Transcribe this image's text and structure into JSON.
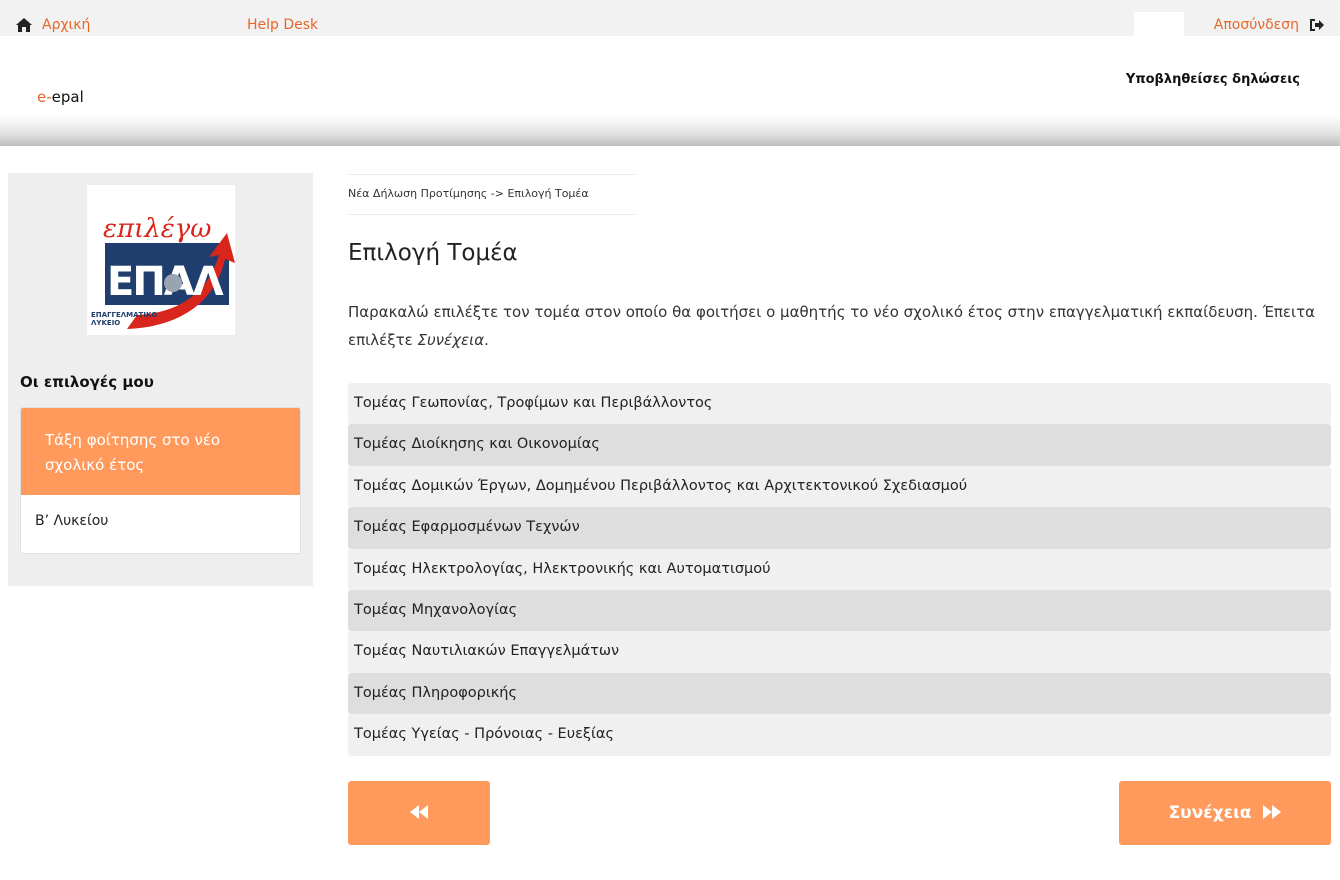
{
  "topbar": {
    "home_label": "Αρχική",
    "home_icon": "home-icon",
    "helpdesk_label": "Help Desk",
    "logout_label": "Αποσύνδεση",
    "logout_icon": "sign-out-icon"
  },
  "header": {
    "logo_prefix": "e-",
    "logo_name": "epal",
    "submitted_link": "Υποβληθείσες δηλώσεις"
  },
  "sidebar": {
    "logo_handwritten": "επιλέγω",
    "logo_letters": "ΕΠΑΛ",
    "logo_caption_line1": "ΕΠΑΓΓΕΛΜΑΤΙΚΟ",
    "logo_caption_line2": "ΛΥΚΕΙΟ",
    "choices_title": "Οι επιλογές μου",
    "card_title": "Τάξη φοίτησης στο νέο σχολικό έτος",
    "card_value": "Β’ Λυκείου"
  },
  "main": {
    "breadcrumb": "Νέα Δήλωση Προτίμησης -> Επιλογή Τομέα",
    "title": "Επιλογή Τομέα",
    "instructions_text": "Παρακαλώ επιλέξτε τον τομέα στον οποίο θα φοιτήσει ο μαθητής το νέο σχολικό έτος στην επαγγελματική εκπαίδευση. Έπειτα επιλέξτε ",
    "instructions_emphasis": "Συνέχεια",
    "instructions_end": ".",
    "sectors": [
      "Τομέας Γεωπονίας, Τροφίμων και Περιβάλλοντος",
      "Τομέας Διοίκησης και Οικονομίας",
      "Τομέας Δομικών Έργων, Δομημένου Περιβάλλοντος και Αρχιτεκτονικού Σχεδιασμού",
      "Τομέας Εφαρμοσμένων Τεχνών",
      "Τομέας Ηλεκτρολογίας, Ηλεκτρονικής και Αυτοματισμού",
      "Τομέας Μηχανολογίας",
      "Τομέας Ναυτιλιακών Επαγγελμάτων",
      "Τομέας Πληροφορικής",
      "Τομέας Υγείας - Πρόνοιας - Ευεξίας"
    ],
    "back_icon": "fast-backward-icon",
    "next_label": "Συνέχεια",
    "next_icon": "fast-forward-icon"
  },
  "colors": {
    "accent": "#ff9a5c",
    "link": "#e8662a",
    "row_light": "#f0f0f0",
    "row_dark": "#dedede"
  }
}
